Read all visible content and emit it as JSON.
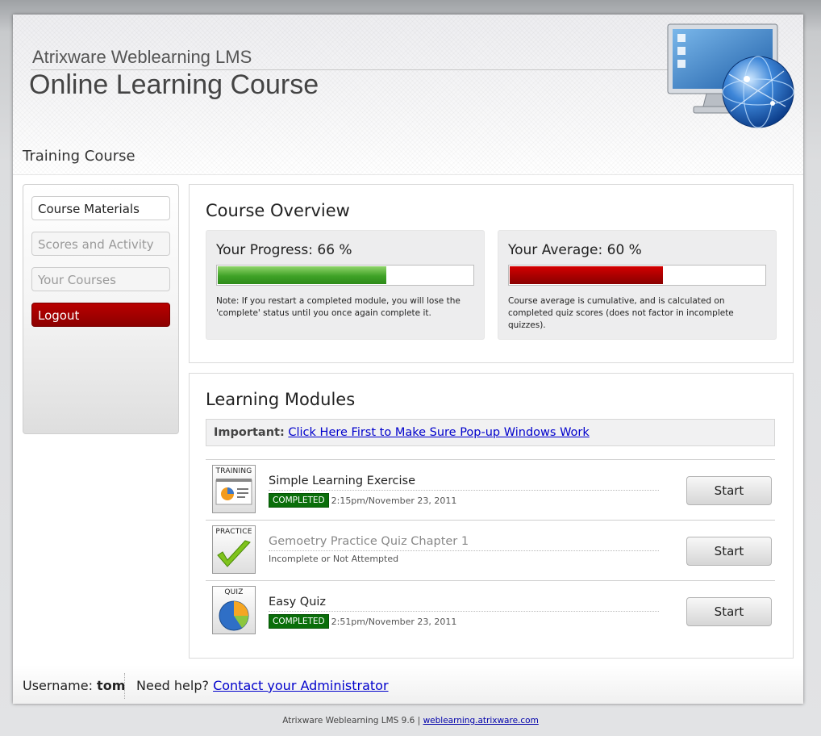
{
  "header": {
    "brand_sub": "Atrixware Weblearning LMS",
    "brand_main": "Online Learning Course",
    "course_title": "Training Course"
  },
  "sidebar": {
    "items": [
      {
        "label": "Course Materials",
        "state": "active"
      },
      {
        "label": "Scores and Activity",
        "state": "inactive"
      },
      {
        "label": "Your Courses",
        "state": "inactive"
      },
      {
        "label": "Logout",
        "state": "logout"
      }
    ]
  },
  "overview": {
    "title": "Course Overview",
    "progress": {
      "label": "Your Progress: 66 %",
      "value": 0.66,
      "note": "Note: If you restart a completed module, you will lose the 'complete' status until you once again complete it.",
      "color": "#3fa227"
    },
    "average": {
      "label": "Your Average: 60 %",
      "value": 0.6,
      "note": "Course average is cumulative, and is calculated on completed quiz scores (does not factor in incomplete quizzes).",
      "color": "#a80000"
    }
  },
  "modules": {
    "title": "Learning Modules",
    "important_label": "Important:",
    "important_link": "Click Here First to Make Sure Pop-up Windows Work",
    "items": [
      {
        "tag": "TRAINING",
        "icon": "presentation-icon",
        "name": "Simple Learning Exercise",
        "badge": "COMPLETED",
        "status": "2:15pm/November 23, 2011",
        "button": "Start",
        "completed": true
      },
      {
        "tag": "PRACTICE",
        "icon": "checkmark-icon",
        "name": "Gemoetry Practice Quiz Chapter 1",
        "badge": "",
        "status": "Incomplete or Not Attempted",
        "button": "Start",
        "completed": false
      },
      {
        "tag": "QUIZ",
        "icon": "pie-chart-icon",
        "name": "Easy Quiz",
        "badge": "COMPLETED",
        "status": "2:51pm/November 23, 2011",
        "button": "Start",
        "completed": true
      }
    ]
  },
  "footer": {
    "username_label": "Username:",
    "username": "tom",
    "help_label": "Need help?",
    "help_link": "Contact your Administrator"
  },
  "page_footer": {
    "version": "Atrixware Weblearning LMS 9.6 |",
    "link": "weblearning.atrixware.com"
  }
}
